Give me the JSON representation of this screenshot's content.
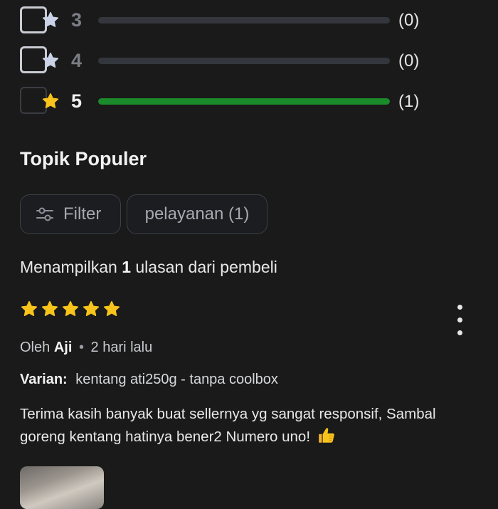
{
  "rating_breakdown": [
    {
      "stars": "3",
      "count_label": "(0)",
      "fraction": 0,
      "enabled": true
    },
    {
      "stars": "4",
      "count_label": "(0)",
      "fraction": 0,
      "enabled": true
    },
    {
      "stars": "5",
      "count_label": "(1)",
      "fraction": 1,
      "enabled": false
    }
  ],
  "popular_topics": {
    "title": "Topik Populer",
    "filter_label": "Filter",
    "topic_chip": "pelayanan (1)"
  },
  "reviews_summary": {
    "prefix": "Menampilkan",
    "count": "1",
    "suffix": "ulasan dari pembeli"
  },
  "review": {
    "rating": 5,
    "by_prefix": "Oleh",
    "author": "Aji",
    "separator": "•",
    "time": "2 hari lalu",
    "variant_label": "Varian:",
    "variant_value": "kentang ati250g - tanpa coolbox",
    "text": "Terima kasih banyak buat sellernya yg sangat responsif, Sambal goreng kentang hatinya bener2 Numero uno!"
  },
  "icons": {
    "star_inactive_color": "#c9d2e6",
    "star_active_color": "#f8c41c",
    "bar_fill_color": "#1a8a2a"
  }
}
